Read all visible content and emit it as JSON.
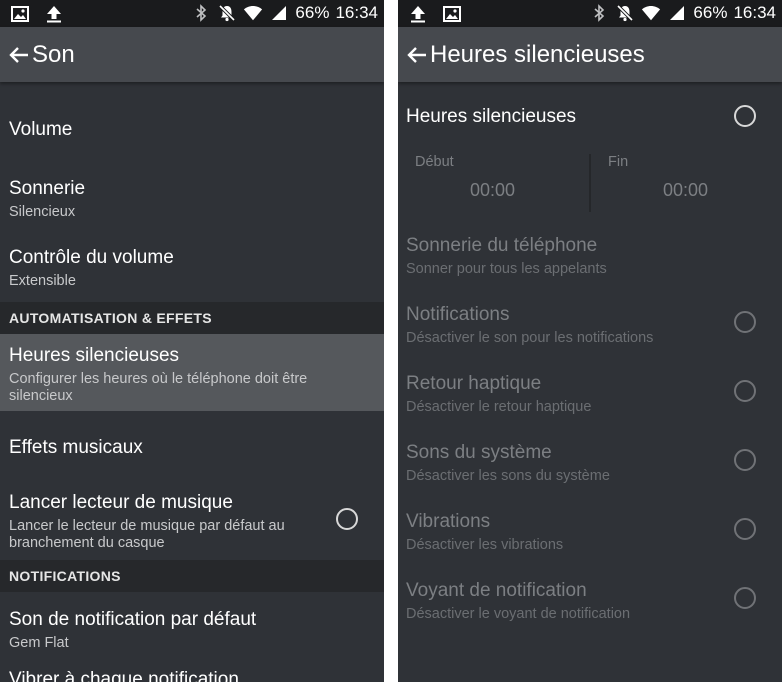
{
  "status_bar": {
    "battery": "66%",
    "time": "16:34"
  },
  "left_screen": {
    "title": "Son",
    "items": [
      {
        "title": "Volume",
        "subtitle": ""
      },
      {
        "title": "Sonnerie",
        "subtitle": "Silencieux"
      },
      {
        "title": "Contrôle du volume",
        "subtitle": "Extensible"
      }
    ],
    "section_automation": "AUTOMATISATION & EFFETS",
    "quiet_hours": {
      "title": "Heures silencieuses",
      "subtitle": "Configurer les heures où le téléphone doit être silencieux"
    },
    "music_effects": {
      "title": "Effets musicaux"
    },
    "launch_player": {
      "title": "Lancer lecteur de musique",
      "subtitle": "Lancer le lecteur de musique par défaut au branchement du casque",
      "checked": false
    },
    "section_notifications": "NOTIFICATIONS",
    "default_notification": {
      "title": "Son de notification par défaut",
      "subtitle": "Gem Flat"
    },
    "vibrate": {
      "title": "Vibrer à chaque notification"
    }
  },
  "right_screen": {
    "title": "Heures silencieuses",
    "toggle": {
      "title": "Heures silencieuses",
      "checked": false
    },
    "start": {
      "label": "Début",
      "value": "00:00"
    },
    "end": {
      "label": "Fin",
      "value": "00:00"
    },
    "ringtone": {
      "title": "Sonnerie du téléphone",
      "subtitle": "Sonner pour tous les appelants"
    },
    "options": [
      {
        "title": "Notifications",
        "subtitle": "Désactiver le son pour les notifications",
        "checked": false
      },
      {
        "title": "Retour haptique",
        "subtitle": "Désactiver le retour haptique",
        "checked": false
      },
      {
        "title": "Sons du système",
        "subtitle": "Désactiver les sons du système",
        "checked": false
      },
      {
        "title": "Vibrations",
        "subtitle": "Désactiver les vibrations",
        "checked": false
      },
      {
        "title": "Voyant de notification",
        "subtitle": "Désactiver le voyant de notification",
        "checked": false
      }
    ]
  }
}
